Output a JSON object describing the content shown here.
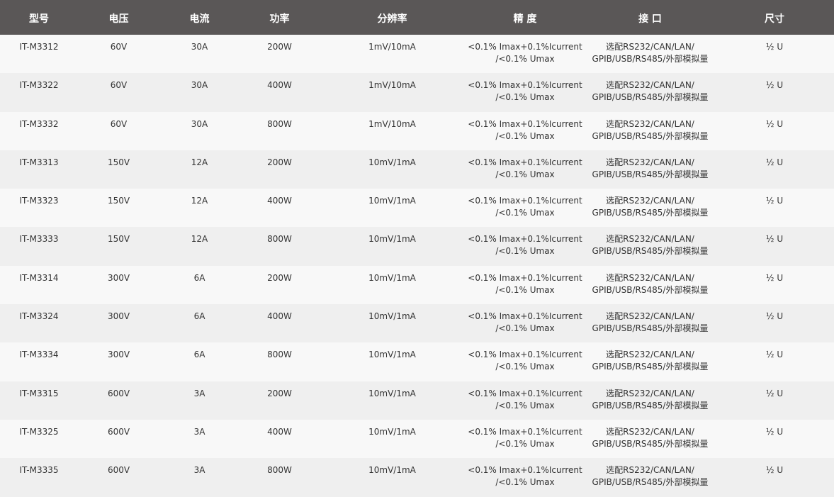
{
  "table": {
    "headers": [
      "型号",
      "电压",
      "电流",
      "功率",
      "分辨率",
      "精 度",
      "接 口",
      "尺寸"
    ],
    "rows": [
      [
        "IT-M3312",
        "60V",
        "30A",
        "200W",
        "1mV/10mA",
        "<0.1% Imax+0.1%Icurrent\n/<0.1% Umax",
        "选配RS232/CAN/LAN/\nGPIB/USB/RS485/外部模拟量",
        "½ U"
      ],
      [
        "IT-M3322",
        "60V",
        "30A",
        "400W",
        "1mV/10mA",
        "<0.1% Imax+0.1%Icurrent\n/<0.1% Umax",
        "选配RS232/CAN/LAN/\nGPIB/USB/RS485/外部模拟量",
        "½ U"
      ],
      [
        "IT-M3332",
        "60V",
        "30A",
        "800W",
        "1mV/10mA",
        "<0.1% Imax+0.1%Icurrent\n/<0.1% Umax",
        "选配RS232/CAN/LAN/\nGPIB/USB/RS485/外部模拟量",
        "½ U"
      ],
      [
        "IT-M3313",
        "150V",
        "12A",
        "200W",
        "10mV/1mA",
        "<0.1% Imax+0.1%Icurrent\n/<0.1% Umax",
        "选配RS232/CAN/LAN/\nGPIB/USB/RS485/外部模拟量",
        "½ U"
      ],
      [
        "IT-M3323",
        "150V",
        "12A",
        "400W",
        "10mV/1mA",
        "<0.1% Imax+0.1%Icurrent\n/<0.1% Umax",
        "选配RS232/CAN/LAN/\nGPIB/USB/RS485/外部模拟量",
        "½ U"
      ],
      [
        "IT-M3333",
        "150V",
        "12A",
        "800W",
        "10mV/1mA",
        "<0.1% Imax+0.1%Icurrent\n/<0.1% Umax",
        "选配RS232/CAN/LAN/\nGPIB/USB/RS485/外部模拟量",
        "½ U"
      ],
      [
        "IT-M3314",
        "300V",
        "6A",
        "200W",
        "10mV/1mA",
        "<0.1% Imax+0.1%Icurrent\n/<0.1% Umax",
        "选配RS232/CAN/LAN/\nGPIB/USB/RS485/外部模拟量",
        "½ U"
      ],
      [
        "IT-M3324",
        "300V",
        "6A",
        "400W",
        "10mV/1mA",
        "<0.1% Imax+0.1%Icurrent\n/<0.1% Umax",
        "选配RS232/CAN/LAN/\nGPIB/USB/RS485/外部模拟量",
        "½ U"
      ],
      [
        "IT-M3334",
        "300V",
        "6A",
        "800W",
        "10mV/1mA",
        "<0.1% Imax+0.1%Icurrent\n/<0.1% Umax",
        "选配RS232/CAN/LAN/\nGPIB/USB/RS485/外部模拟量",
        "½ U"
      ],
      [
        "IT-M3315",
        "600V",
        "3A",
        "200W",
        "10mV/1mA",
        "<0.1% Imax+0.1%Icurrent\n/<0.1% Umax",
        "选配RS232/CAN/LAN/\nGPIB/USB/RS485/外部模拟量",
        "½ U"
      ],
      [
        "IT-M3325",
        "600V",
        "3A",
        "400W",
        "10mV/1mA",
        "<0.1% Imax+0.1%Icurrent\n/<0.1% Umax",
        "选配RS232/CAN/LAN/\nGPIB/USB/RS485/外部模拟量",
        "½ U"
      ],
      [
        "IT-M3335",
        "600V",
        "3A",
        "800W",
        "10mV/1mA",
        "<0.1% Imax+0.1%Icurrent\n/<0.1% Umax",
        "选配RS232/CAN/LAN/\nGPIB/USB/RS485/外部模拟量",
        "½ U"
      ]
    ]
  }
}
